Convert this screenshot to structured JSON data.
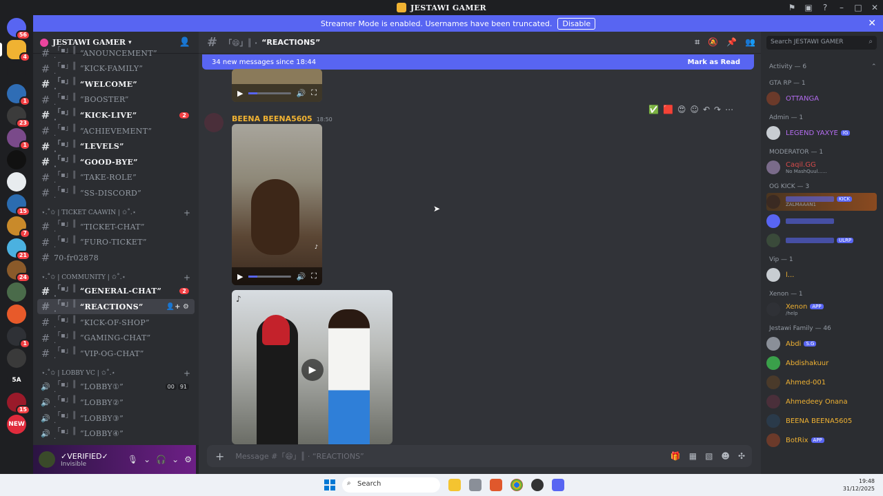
{
  "window": {
    "title": "JESTAWI GAMER",
    "colors": {
      "accent": "#5865f2",
      "bg": "#313338",
      "sidebar": "#2b2d31",
      "mention": "#f23f43"
    }
  },
  "banner": {
    "text": "Streamer Mode is enabled. Usernames have been truncated.",
    "button": "Disable"
  },
  "server_rail": [
    {
      "icon": "discord-home-icon",
      "badge": "56"
    },
    {
      "icon": "jestawi-server-icon",
      "badge": "4"
    },
    {
      "icon": "server-icon",
      "badge": ""
    },
    {
      "icon": "server-icon",
      "badge": "1"
    },
    {
      "icon": "server-icon",
      "badge": "23"
    },
    {
      "icon": "server-icon",
      "badge": "1"
    },
    {
      "icon": "server-icon",
      "badge": ""
    },
    {
      "icon": "server-icon",
      "badge": ""
    },
    {
      "icon": "server-icon",
      "badge": "15"
    },
    {
      "icon": "server-icon",
      "badge": "7"
    },
    {
      "icon": "server-icon",
      "badge": "21"
    },
    {
      "icon": "server-icon",
      "badge": "24"
    },
    {
      "icon": "server-icon",
      "badge": ""
    },
    {
      "icon": "server-icon",
      "badge": ""
    },
    {
      "icon": "server-icon",
      "badge": "1"
    },
    {
      "icon": "server-icon",
      "badge": ""
    },
    {
      "icon": "server-text-icon",
      "label": "5A",
      "badge": ""
    },
    {
      "icon": "server-icon",
      "badge": "15"
    },
    {
      "icon": "new-badge-icon",
      "label": "NEW",
      "badge": ""
    }
  ],
  "sidebar": {
    "server_name": "JESTAWI GAMER",
    "channels": [
      {
        "type": "text",
        "name": "“ANOUNCEMENT”",
        "state": "normal"
      },
      {
        "type": "text",
        "name": "“KICK-FAMILY”",
        "state": "normal"
      },
      {
        "type": "text",
        "name": "“WELCOME”",
        "state": "unread"
      },
      {
        "type": "text",
        "name": "“BOOSTER”",
        "state": "normal"
      },
      {
        "type": "text",
        "name": "“KICK-LIVE”",
        "state": "unread",
        "mention": "2"
      },
      {
        "type": "text",
        "name": "“ACHIEVEMENT”",
        "state": "normal"
      },
      {
        "type": "text",
        "name": "“LEVELS”",
        "state": "unread"
      },
      {
        "type": "text",
        "name": "“GOOD-BYE”",
        "state": "unread"
      },
      {
        "type": "text",
        "name": "“TAKE-ROLE”",
        "state": "normal"
      },
      {
        "type": "text",
        "name": "“SS-DISCORD”",
        "state": "normal"
      },
      {
        "type": "category",
        "name": "⋆.˚✩ | TICKET CAAWIN | ✩˚.⋆"
      },
      {
        "type": "text",
        "name": "“TICKET-CHAT”",
        "state": "normal"
      },
      {
        "type": "text",
        "name": "“FURO-TICKET”",
        "state": "normal"
      },
      {
        "type": "plain",
        "name": "70-fr02878",
        "state": "normal"
      },
      {
        "type": "category",
        "name": "⋆.˚✩ | COMMUNITY | ✩˚.⋆"
      },
      {
        "type": "text",
        "name": "“GENERAL-CHAT”",
        "state": "unread",
        "mention": "2"
      },
      {
        "type": "text",
        "name": "“REACTIONS”",
        "state": "selected"
      },
      {
        "type": "text",
        "name": "“KICK-OF-SHOP”",
        "state": "normal"
      },
      {
        "type": "text",
        "name": "“GAMING-CHAT”",
        "state": "normal"
      },
      {
        "type": "text",
        "name": "“VIP-OG-CHAT”",
        "state": "normal"
      },
      {
        "type": "category",
        "name": "⋆.˚✩ | LOBBY VC | ✩˚.⋆"
      },
      {
        "type": "voice",
        "name": "“LOBBY①”",
        "state": "normal",
        "counts": [
          "00",
          "91"
        ]
      },
      {
        "type": "voice",
        "name": "“LOBBY②”",
        "state": "normal"
      },
      {
        "type": "voice",
        "name": "“LOBBY③”",
        "state": "normal"
      },
      {
        "type": "voice",
        "name": "“LOBBY④”",
        "state": "normal"
      }
    ]
  },
  "user": {
    "name": "✓VERIFIED✓",
    "status": "Invisible"
  },
  "chat": {
    "channel_name": "“REACTIONS”",
    "new_messages": "34 new messages since 18:44",
    "mark_as_read": "Mark as Read",
    "message": {
      "author": "BEENA BEENA5605",
      "time": "18:50"
    },
    "composer_placeholder": "Message #「😄」║ · “REACTIONS”"
  },
  "members": {
    "search_placeholder": "Search JESTAWI GAMER",
    "activity": "Activity — 6",
    "groups": [
      {
        "title": "GTA RP — 1",
        "members": [
          {
            "name": "OTTANGA",
            "color": "#b46cf0",
            "sub": ""
          }
        ]
      },
      {
        "title": "Admin — 1",
        "members": [
          {
            "name": "LEGEND YAXYE",
            "color": "#b46cf0",
            "sub": "",
            "tag": "IG"
          }
        ]
      },
      {
        "title": "MODERATOR — 1",
        "members": [
          {
            "name": "Caqil.GG",
            "color": "#d64b4b",
            "sub": "No MashQuul......"
          }
        ]
      },
      {
        "title": "OG KICK — 3",
        "members": [
          {
            "name": "",
            "color": "#5865f2",
            "sub": "ZALMAAAN1",
            "tag": "KICK"
          },
          {
            "name": "",
            "color": "#5865f2",
            "sub": ""
          },
          {
            "name": "",
            "color": "#5865f2",
            "sub": "",
            "tag": "ULRP"
          }
        ]
      },
      {
        "title": "Vip — 1",
        "members": [
          {
            "name": "l...",
            "color": "#f0b232",
            "sub": ""
          }
        ]
      },
      {
        "title": "Xenon — 1",
        "members": [
          {
            "name": "Xenon",
            "color": "#f0b232",
            "sub": "/help",
            "tag": "APP"
          }
        ]
      },
      {
        "title": "Jestawi Family — 46",
        "members": [
          {
            "name": "Abdi",
            "color": "#f0b232",
            "sub": "",
            "tag": "S.G"
          },
          {
            "name": "Abdishakuur",
            "color": "#f0b232",
            "sub": ""
          },
          {
            "name": "Ahmed-001",
            "color": "#f0b232",
            "sub": ""
          },
          {
            "name": "Ahmedeey Onana",
            "color": "#f0b232",
            "sub": ""
          },
          {
            "name": "BEENA BEENA5605",
            "color": "#f0b232",
            "sub": ""
          },
          {
            "name": "BotRix",
            "color": "#f0b232",
            "sub": "",
            "tag": "APP"
          }
        ]
      }
    ]
  },
  "taskbar": {
    "search": "Search",
    "time": "19:48",
    "date": "31/12/2025"
  }
}
